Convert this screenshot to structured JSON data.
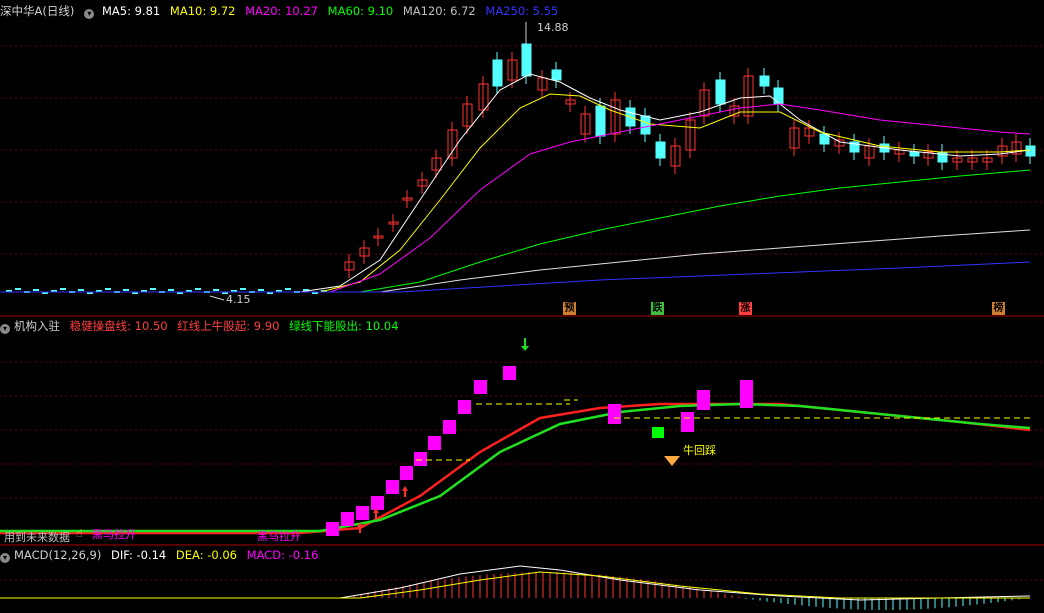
{
  "app": {
    "stock_name": "深中华A(日线)",
    "colors": {
      "up": "#ff3232",
      "down": "#54ffff",
      "grid": "#7a0000",
      "border": "#aa0000"
    }
  },
  "main_panel": {
    "indicators": [
      {
        "label": "MA5: 9.81",
        "color": "#ffffff"
      },
      {
        "label": "MA10: 9.72",
        "color": "#ffff00"
      },
      {
        "label": "MA20: 10.27",
        "color": "#ff00ff"
      },
      {
        "label": "MA60: 9.10",
        "color": "#00ff00"
      },
      {
        "label": "MA120: 6.72",
        "color": "#c0c0c0"
      },
      {
        "label": "MA250: 5.55",
        "color": "#3232ff"
      }
    ],
    "high_label": "14.88",
    "low_label": "4.15",
    "events": [
      {
        "text": "预",
        "bg": "#d08030"
      },
      {
        "text": "跌",
        "bg": "#3fbf3f"
      },
      {
        "text": "涨",
        "bg": "#ff4040"
      },
      {
        "text": "榜",
        "bg": "#d08030"
      }
    ]
  },
  "sub_panel": {
    "title": "机构入驻",
    "indicators": [
      {
        "label": "稳健操盘线: 10.50",
        "color": "#ff4040"
      },
      {
        "label": "红线上牛股起: 9.90",
        "color": "#ff4040"
      },
      {
        "label": "绿线下能股出: 10.04",
        "color": "#00ff00"
      }
    ],
    "annotations": {
      "future_data": "用到未来数据",
      "black_horse_1": "黑马拉升",
      "black_horse_2": "黑马拉升",
      "bull_pullback": "牛回踩"
    }
  },
  "macd_panel": {
    "title": "MACD(12,26,9)",
    "indicators": [
      {
        "label": "DIF: -0.14",
        "color": "#ffffff"
      },
      {
        "label": "DEA: -0.06",
        "color": "#ffff00"
      },
      {
        "label": "MACD: -0.16",
        "color": "#ff00ff"
      }
    ]
  }
}
